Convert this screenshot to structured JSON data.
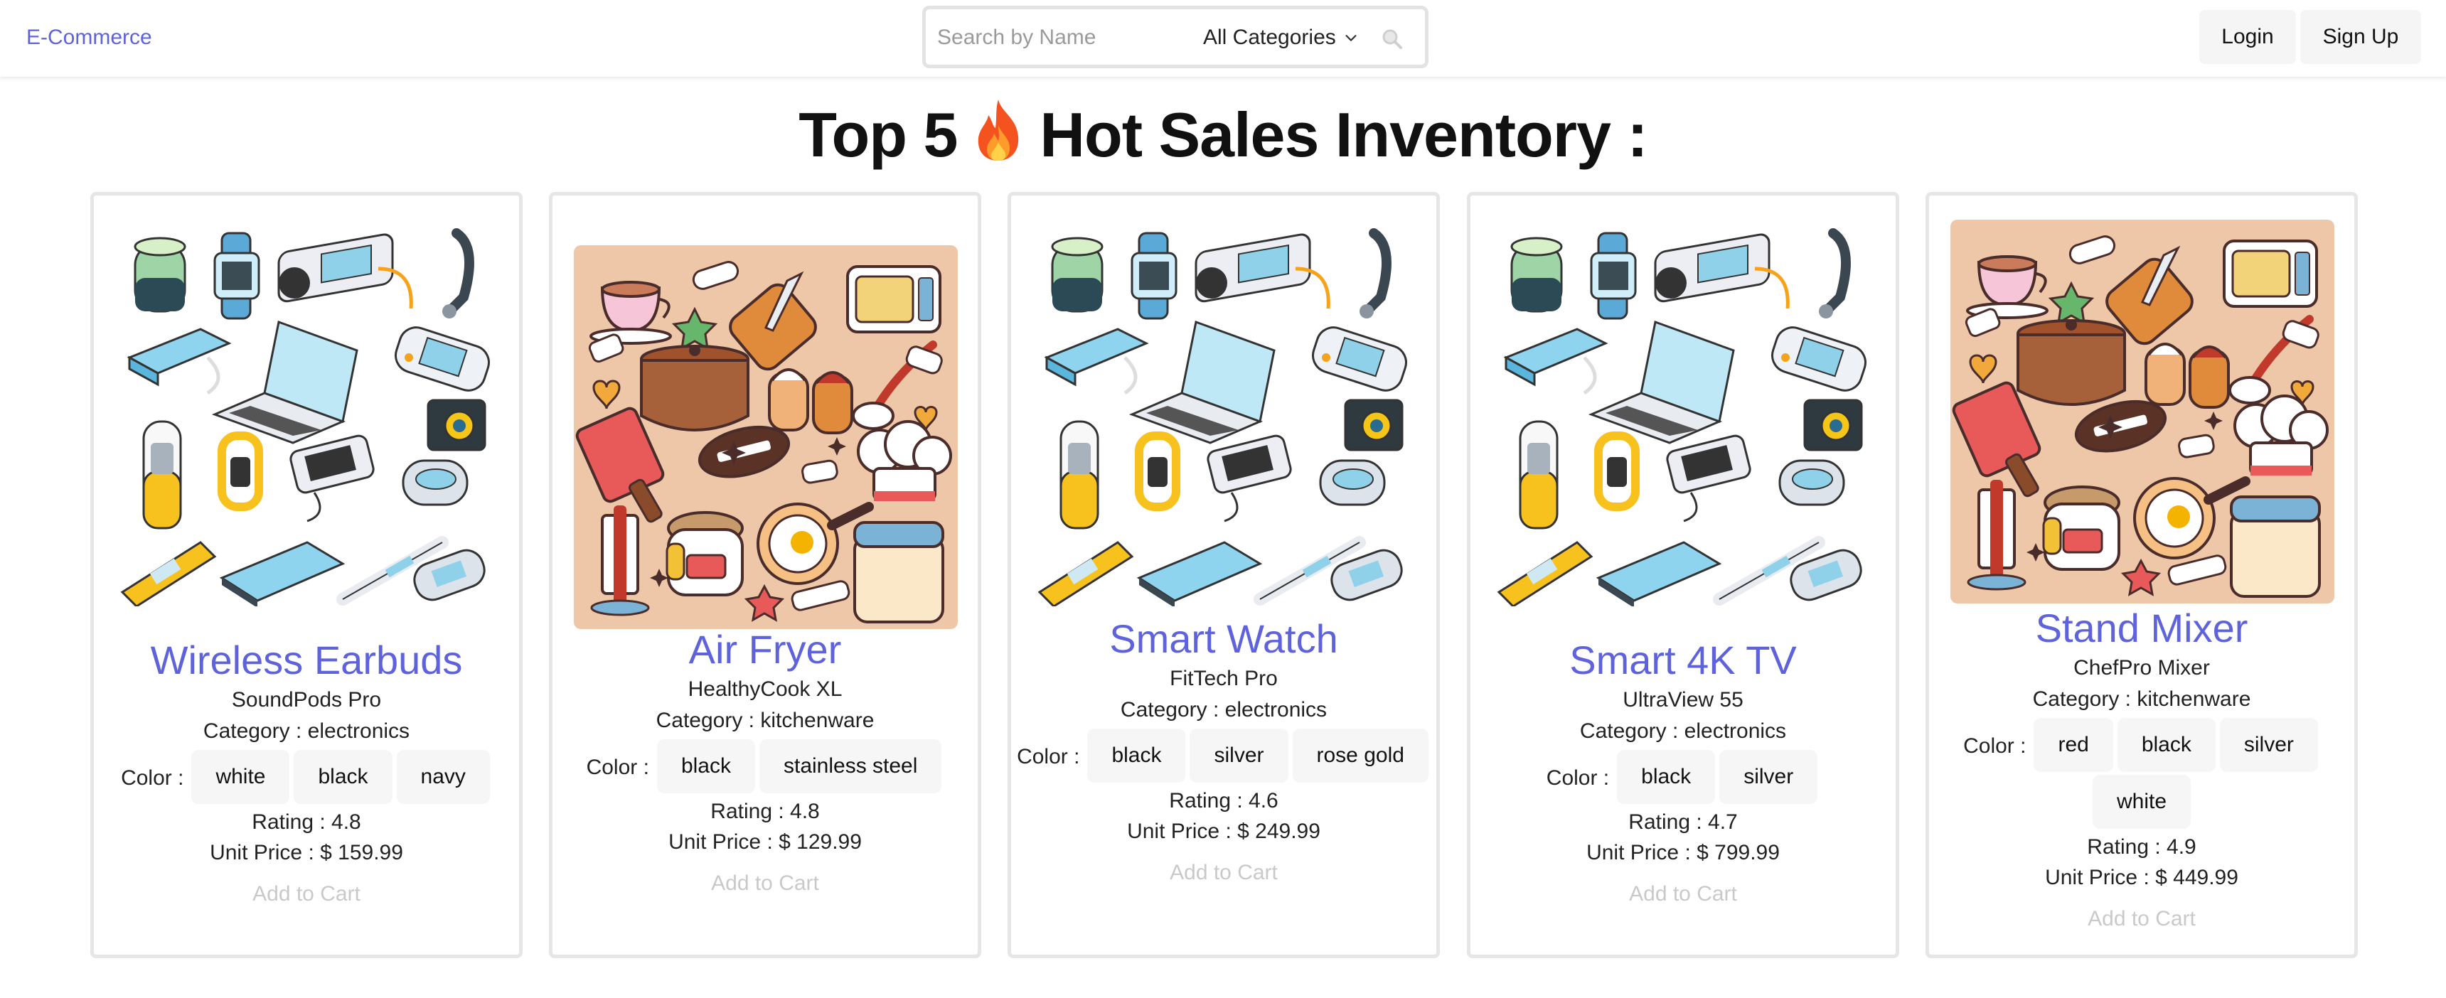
{
  "header": {
    "brand": "E-Commerce",
    "search_placeholder": "Search by Name",
    "category_selected": "All Categories",
    "login_label": "Login",
    "signup_label": "Sign Up"
  },
  "page": {
    "title_before": "Top 5",
    "title_after": "Hot Sales Inventory :"
  },
  "labels": {
    "category_prefix": "Category : ",
    "color_prefix": "Color :",
    "rating_prefix": "Rating : ",
    "price_prefix": "Unit Price : $ ",
    "add_to_cart": "Add to Cart"
  },
  "products": [
    {
      "name": "Wireless Earbuds",
      "model": "SoundPods Pro",
      "category": "electronics",
      "colors": [
        "white",
        "black",
        "navy"
      ],
      "rating": "4.8",
      "price": "159.99",
      "image": "electronics-icons"
    },
    {
      "name": "Air Fryer",
      "model": "HealthyCook XL",
      "category": "kitchenware",
      "colors": [
        "black",
        "stainless steel"
      ],
      "rating": "4.8",
      "price": "129.99",
      "image": "kitchen-stickers"
    },
    {
      "name": "Smart Watch",
      "model": "FitTech Pro",
      "category": "electronics",
      "colors": [
        "black",
        "silver",
        "rose gold"
      ],
      "rating": "4.6",
      "price": "249.99",
      "image": "electronics-icons"
    },
    {
      "name": "Smart 4K TV",
      "model": "UltraView 55",
      "category": "electronics",
      "colors": [
        "black",
        "silver"
      ],
      "rating": "4.7",
      "price": "799.99",
      "image": "electronics-icons"
    },
    {
      "name": "Stand Mixer",
      "model": "ChefPro Mixer",
      "category": "kitchenware",
      "colors": [
        "red",
        "black",
        "silver",
        "white"
      ],
      "rating": "4.9",
      "price": "449.99",
      "image": "kitchen-stickers"
    }
  ],
  "colors": {
    "accent": "#5e63dc",
    "chip_bg": "#f6f6f6",
    "kitchen_bg": "#eec7a9"
  }
}
